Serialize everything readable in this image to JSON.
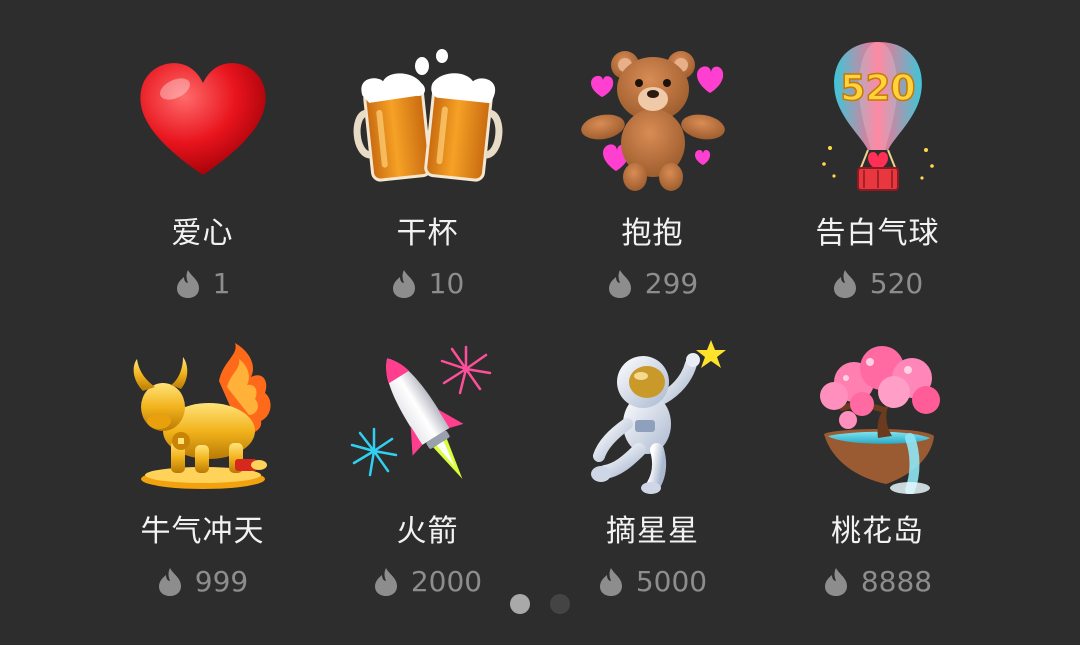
{
  "colors": {
    "background": "#2d2d2d",
    "name_text": "#f2f2f2",
    "price_text": "#8d8d8d",
    "dot_active": "#a9a9a9",
    "dot_inactive": "#444444"
  },
  "price_icon": "flame-icon",
  "gifts": [
    {
      "name": "爱心",
      "price": "1",
      "icon": "heart-icon"
    },
    {
      "name": "干杯",
      "price": "10",
      "icon": "beer-mugs-icon"
    },
    {
      "name": "抱抱",
      "price": "299",
      "icon": "teddy-bear-icon"
    },
    {
      "name": "告白气球",
      "price": "520",
      "icon": "hot-air-balloon-icon",
      "icon_text": "520"
    },
    {
      "name": "牛气冲天",
      "price": "999",
      "icon": "golden-ox-icon"
    },
    {
      "name": "火箭",
      "price": "2000",
      "icon": "rocket-icon"
    },
    {
      "name": "摘星星",
      "price": "5000",
      "icon": "astronaut-icon"
    },
    {
      "name": "桃花岛",
      "price": "8888",
      "icon": "peach-blossom-island-icon"
    }
  ],
  "pagination": {
    "total": 2,
    "current": 1
  }
}
